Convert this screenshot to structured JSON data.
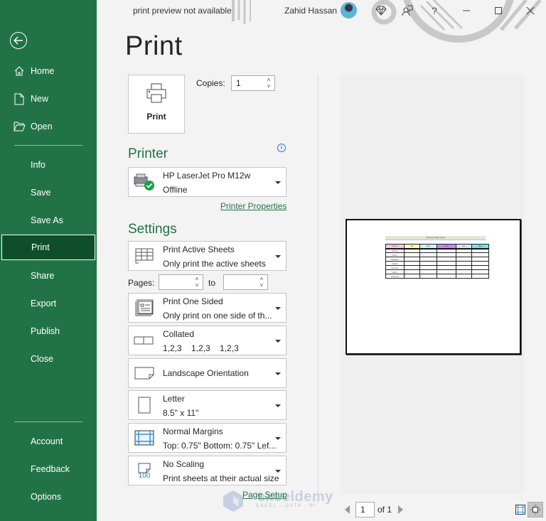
{
  "titlebar": {
    "status": "print preview not available",
    "user_name": "Zahid Hassan",
    "icons": [
      "diamond-icon",
      "coauthor-icon",
      "help-icon",
      "minimize-icon",
      "maximize-icon",
      "close-icon"
    ],
    "help_glyph": "?"
  },
  "sidebar": {
    "top_items": [
      {
        "label": "Home",
        "icon": "home-icon"
      },
      {
        "label": "New",
        "icon": "new-document-icon"
      },
      {
        "label": "Open",
        "icon": "folder-open-icon"
      }
    ],
    "mid_items": [
      {
        "label": "Info"
      },
      {
        "label": "Save"
      },
      {
        "label": "Save As"
      },
      {
        "label": "Print",
        "active": true
      },
      {
        "label": "Share"
      },
      {
        "label": "Export"
      },
      {
        "label": "Publish"
      },
      {
        "label": "Close"
      }
    ],
    "bottom_items": [
      {
        "label": "Account"
      },
      {
        "label": "Feedback"
      },
      {
        "label": "Options"
      }
    ],
    "colors": {
      "background": "#217346",
      "active": "#0e4f29"
    }
  },
  "main": {
    "title": "Print",
    "print_button_label": "Print",
    "copies_label": "Copies:",
    "copies_value": "1",
    "printer_heading": "Printer",
    "printer": {
      "name": "HP LaserJet Pro M12w",
      "status": "Offline"
    },
    "printer_properties_link": "Printer Properties",
    "settings_heading": "Settings",
    "settings": [
      {
        "title": "Print Active Sheets",
        "subtitle": "Only print the active sheets",
        "icon": "sheets-icon"
      },
      {
        "title": "Print One Sided",
        "subtitle": "Only print on one side of th...",
        "icon": "one-sided-icon"
      },
      {
        "title": "Collated",
        "subtitle": "1,2,3    1,2,3    1,2,3",
        "icon": "collated-icon"
      },
      {
        "title": "Landscape Orientation",
        "subtitle": "",
        "icon": "landscape-icon"
      },
      {
        "title": "Letter",
        "subtitle": "8.5\" x 11\"",
        "icon": "paper-size-icon"
      },
      {
        "title": "Normal Margins",
        "subtitle": "Top: 0.75\" Bottom: 0.75\" Lef...",
        "icon": "margins-icon"
      },
      {
        "title": "No Scaling",
        "subtitle": "Print sheets at their actual size",
        "icon": "scaling-icon",
        "icon_text": "100"
      }
    ],
    "pages_label": "Pages:",
    "pages_from": "",
    "pages_to_label": "to",
    "pages_to": "",
    "page_setup_link": "Page Setup",
    "accent": "#217346"
  },
  "preview": {
    "sheet_title": "Monthly Sales Data",
    "header_colors": [
      "#ffc6f0",
      "#fff9b8",
      "#c9f4f7",
      "#c48ef0",
      "#dce6f2",
      "#66ecec"
    ],
    "columns": [
      "Name",
      "Jan",
      "Feb",
      "Mar",
      "Apr",
      "May"
    ],
    "rows": [
      [
        "James",
        "",
        "",
        "",
        "",
        ""
      ],
      [
        "Peter",
        "",
        "",
        "",
        "",
        ""
      ],
      [
        "Michael",
        "",
        "",
        "",
        "",
        ""
      ],
      [
        "Sarah",
        "",
        "",
        "",
        "",
        ""
      ],
      [
        "Samuel",
        "",
        "",
        "",
        "",
        ""
      ],
      [
        "Harry",
        "",
        "",
        "",
        "",
        ""
      ],
      [
        "Anthony",
        "",
        "",
        "",
        "",
        ""
      ]
    ],
    "current_page": "1",
    "page_total_label": "of 1"
  },
  "watermark": {
    "name": "exceldemy",
    "sub": "EXCEL · DATA · BI"
  }
}
